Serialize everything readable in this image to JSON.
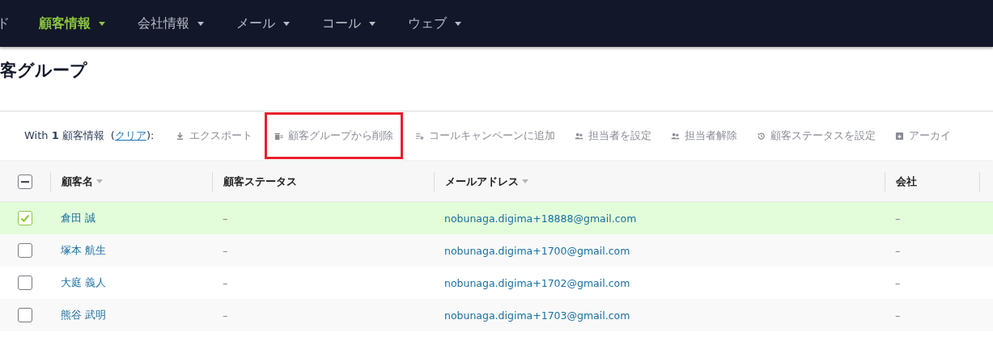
{
  "nav": [
    {
      "label": "ド",
      "selected": false,
      "dropdown": false
    },
    {
      "label": "顧客情報",
      "selected": true,
      "dropdown": true
    },
    {
      "label": "会社情報",
      "selected": false,
      "dropdown": true
    },
    {
      "label": "メール",
      "selected": false,
      "dropdown": true
    },
    {
      "label": "コール",
      "selected": false,
      "dropdown": true
    },
    {
      "label": "ウェブ",
      "selected": false,
      "dropdown": true
    }
  ],
  "page_title": "客グループ",
  "selection": {
    "text": "With **1** 顧客情報",
    "open_paren": "(",
    "clear_link": "クリア",
    "close_paren": "):"
  },
  "actions": [
    {
      "kind": "download",
      "label": "エクスポート",
      "highlighted": false
    },
    {
      "kind": "trash",
      "label": "顧客グループから削除",
      "highlighted": true
    },
    {
      "kind": "list-add",
      "label": "コールキャンペーンに追加",
      "highlighted": false
    },
    {
      "kind": "people",
      "label": "担当者を設定",
      "highlighted": false
    },
    {
      "kind": "people",
      "label": "担当者解除",
      "highlighted": false
    },
    {
      "kind": "history",
      "label": "顧客ステータスを設定",
      "highlighted": false
    },
    {
      "kind": "archive",
      "label": "アーカイ",
      "highlighted": false
    }
  ],
  "table": {
    "select_all_partial": true,
    "columns": [
      {
        "label": "顧客名",
        "sortable": true
      },
      {
        "label": "顧客ステータス",
        "sortable": false
      },
      {
        "label": "メールアドレス",
        "sortable": true
      },
      {
        "label": "会社",
        "sortable": false
      }
    ],
    "rows": [
      {
        "checked": true,
        "name": "倉田 誠",
        "status": "–",
        "email": "nobunaga.digima+18888@gmail.com",
        "company": "–"
      },
      {
        "checked": false,
        "name": "塚本 航生",
        "status": "–",
        "email": "nobunaga.digima+1700@gmail.com",
        "company": "–"
      },
      {
        "checked": false,
        "name": "大庭 義人",
        "status": "–",
        "email": "nobunaga.digima+1702@gmail.com",
        "company": "–"
      },
      {
        "checked": false,
        "name": "熊谷 武明",
        "status": "–",
        "email": "nobunaga.digima+1703@gmail.com",
        "company": "–"
      }
    ]
  }
}
